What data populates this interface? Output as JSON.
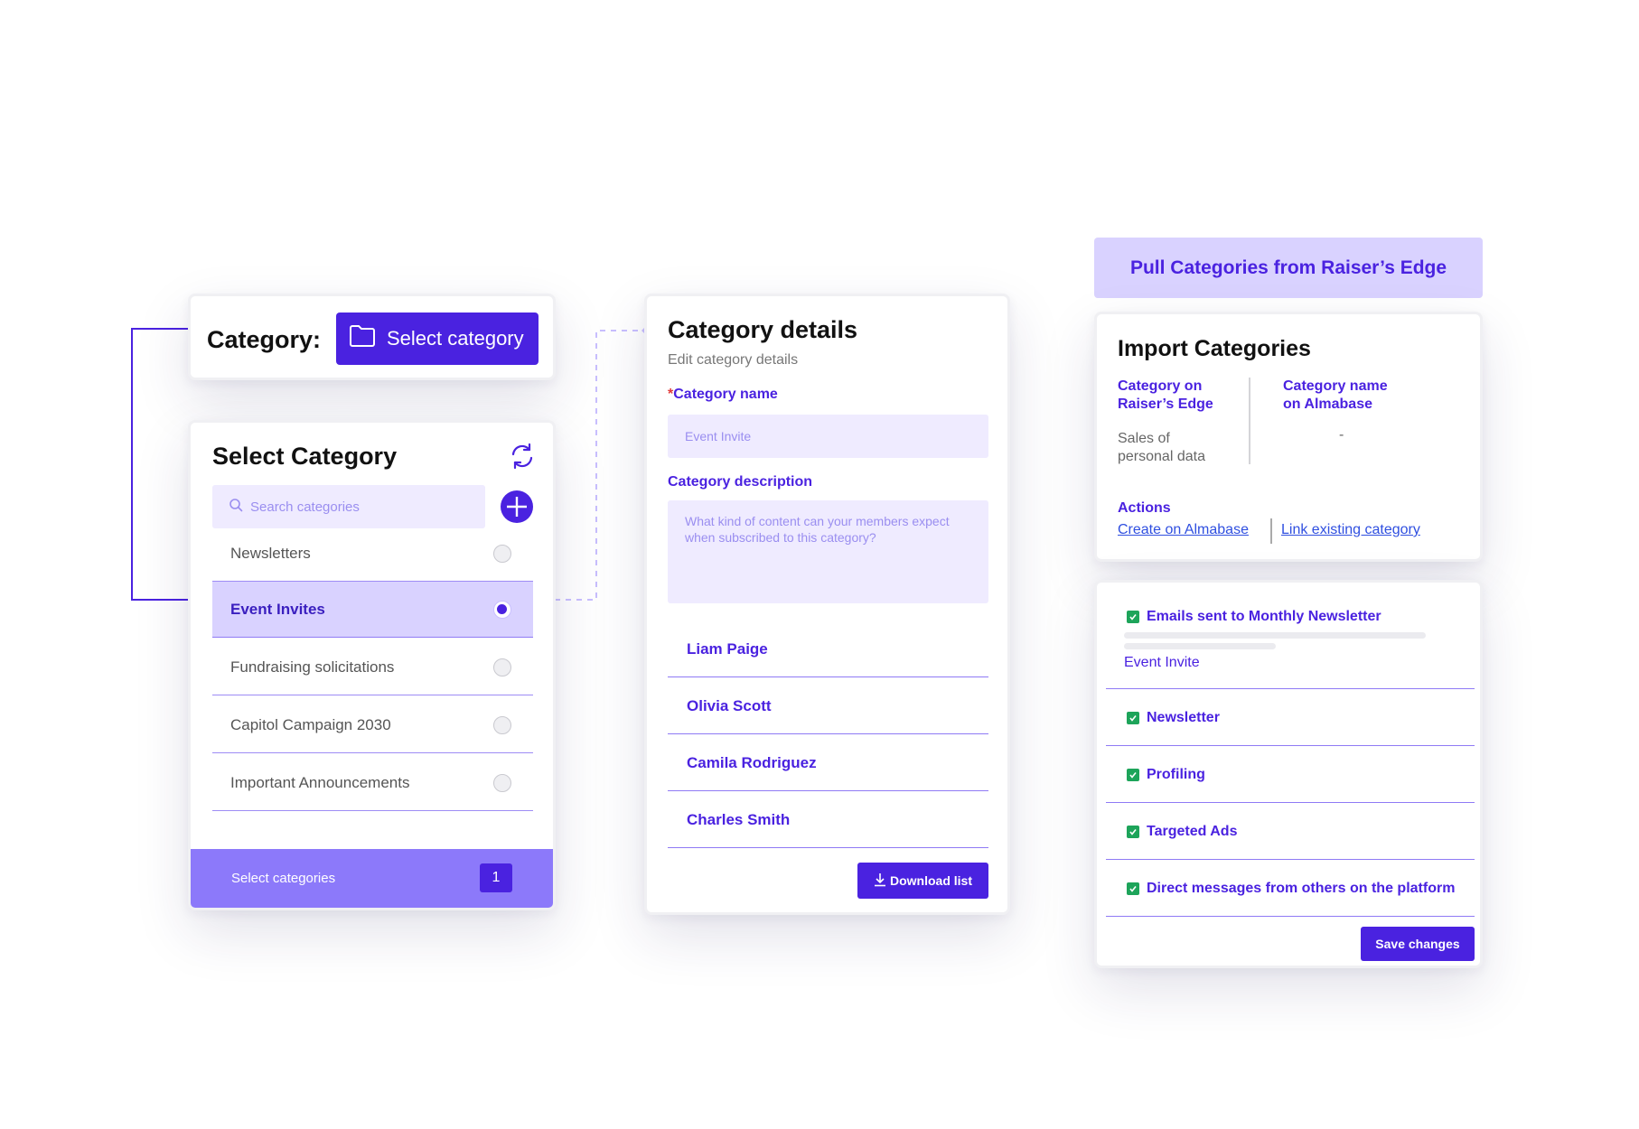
{
  "category_picker": {
    "label": "Category:",
    "button_label": "Select category",
    "button_icon": "folder-icon"
  },
  "select_category": {
    "title": "Select Category",
    "refresh_icon": "refresh-icon",
    "search_placeholder": "Search categories",
    "add_icon": "plus-icon",
    "items": [
      {
        "label": "Newsletters",
        "selected": false
      },
      {
        "label": "Event Invites",
        "selected": true
      },
      {
        "label": "Fundraising solicitations",
        "selected": false
      },
      {
        "label": "Capitol Campaign 2030",
        "selected": false
      },
      {
        "label": "Important Announcements",
        "selected": false
      }
    ],
    "footer_label": "Select categories",
    "footer_count": "1"
  },
  "category_details": {
    "title": "Category details",
    "subtitle": "Edit category details",
    "name_required_mark": "*",
    "name_label": "Category name",
    "name_value": "Event Invite",
    "description_label": "Category description",
    "description_placeholder": "What kind of content can your members expect when subscribed to this category?",
    "people": [
      "Liam Paige",
      "Olivia Scott",
      "Camila Rodriguez",
      "Charles Smith"
    ],
    "download_label": "Download list"
  },
  "pull_header": {
    "label": "Pull Categories from Raiser’s Edge"
  },
  "import_categories": {
    "title": "Import Categories",
    "col1_header_line1": "Category on",
    "col1_header_line2": "Raiser’s Edge",
    "col1_value_line1": "Sales of",
    "col1_value_line2": "personal data",
    "col2_header_line1": "Category name",
    "col2_header_line2": "on Almabase",
    "col2_value": "-",
    "actions_label": "Actions",
    "action_create": "Create on Almabase",
    "action_link": "Link existing category"
  },
  "checklist": {
    "items": [
      {
        "label": "Emails sent to Monthly  Newsletter",
        "sub": "Event Invite",
        "checked": true
      },
      {
        "label": "Newsletter",
        "checked": true
      },
      {
        "label": "Profiling",
        "checked": true
      },
      {
        "label": "Targeted Ads",
        "checked": true
      },
      {
        "label": "Direct messages from others on the platform",
        "checked": true
      }
    ],
    "save_label": "Save changes"
  },
  "colors": {
    "accent": "#4a22e0",
    "accent_light": "#d9d2ff",
    "field_bg": "#efebff",
    "footer_bg": "#8c79fa",
    "check_green": "#1da45a"
  }
}
